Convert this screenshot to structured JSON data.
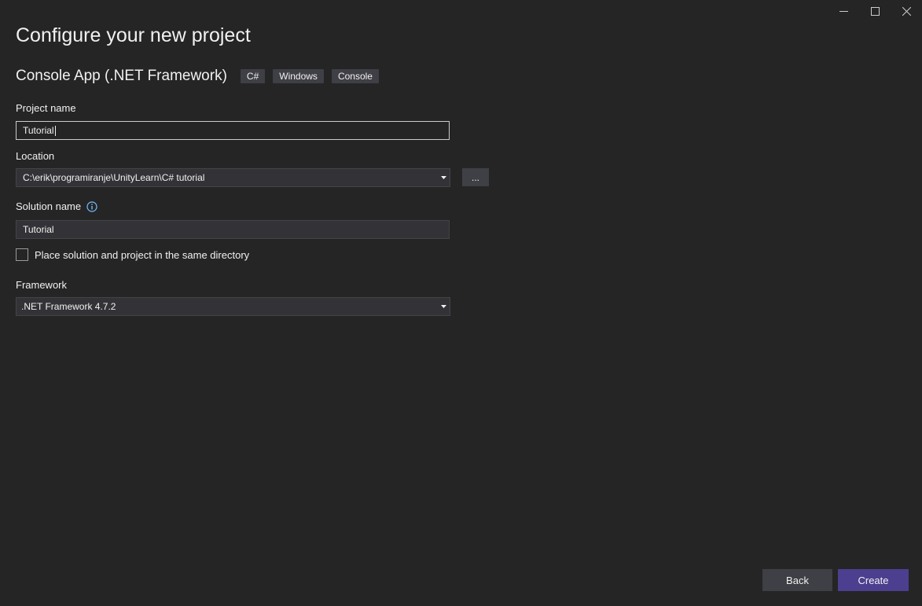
{
  "window": {
    "controls": [
      {
        "name": "minimize",
        "icon": "minimize-icon"
      },
      {
        "name": "maximize",
        "icon": "maximize-icon"
      },
      {
        "name": "close",
        "icon": "close-icon"
      }
    ]
  },
  "header": {
    "title": "Configure your new project"
  },
  "template": {
    "name": "Console App (.NET Framework)",
    "tags": [
      "C#",
      "Windows",
      "Console"
    ]
  },
  "form": {
    "project_name": {
      "label": "Project name",
      "value": "Tutorial"
    },
    "location": {
      "label": "Location",
      "value": "C:\\erik\\programiranje\\UnityLearn\\C# tutorial",
      "browse_label": "..."
    },
    "solution_name": {
      "label": "Solution name",
      "value": "Tutorial",
      "info_icon": "info-icon"
    },
    "same_directory": {
      "label": "Place solution and project in the same directory",
      "checked": false
    },
    "framework": {
      "label": "Framework",
      "value": ".NET Framework 4.7.2"
    }
  },
  "footer": {
    "back_label": "Back",
    "create_label": "Create"
  },
  "colors": {
    "background": "#252526",
    "accent": "#4c3f8f",
    "info": "#75beff"
  }
}
